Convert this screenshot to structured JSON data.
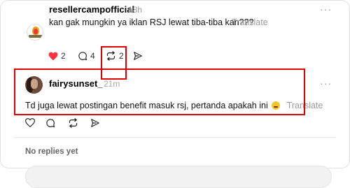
{
  "post": {
    "username": "resellercampofficial",
    "time": "18h",
    "text": "kan gak mungkin ya iklan RSJ lewat tiba-tiba kan???",
    "translate": "Translate",
    "more": "···",
    "likes": "2",
    "replies": "4",
    "reposts": "2"
  },
  "reply": {
    "username": "fairysunset_",
    "time": "21m",
    "text": "Td juga lewat postingan benefit masuk rsj, pertanda apakah ini",
    "translate": "Translate",
    "more": "···"
  },
  "no_replies": "No replies yet",
  "colors": {
    "like": "#ff3040",
    "highlight": "#e00000",
    "muted": "#999999"
  },
  "icons": [
    "heart-icon",
    "comment-icon",
    "repost-icon",
    "share-icon",
    "crying-emoji",
    "more-icon"
  ]
}
